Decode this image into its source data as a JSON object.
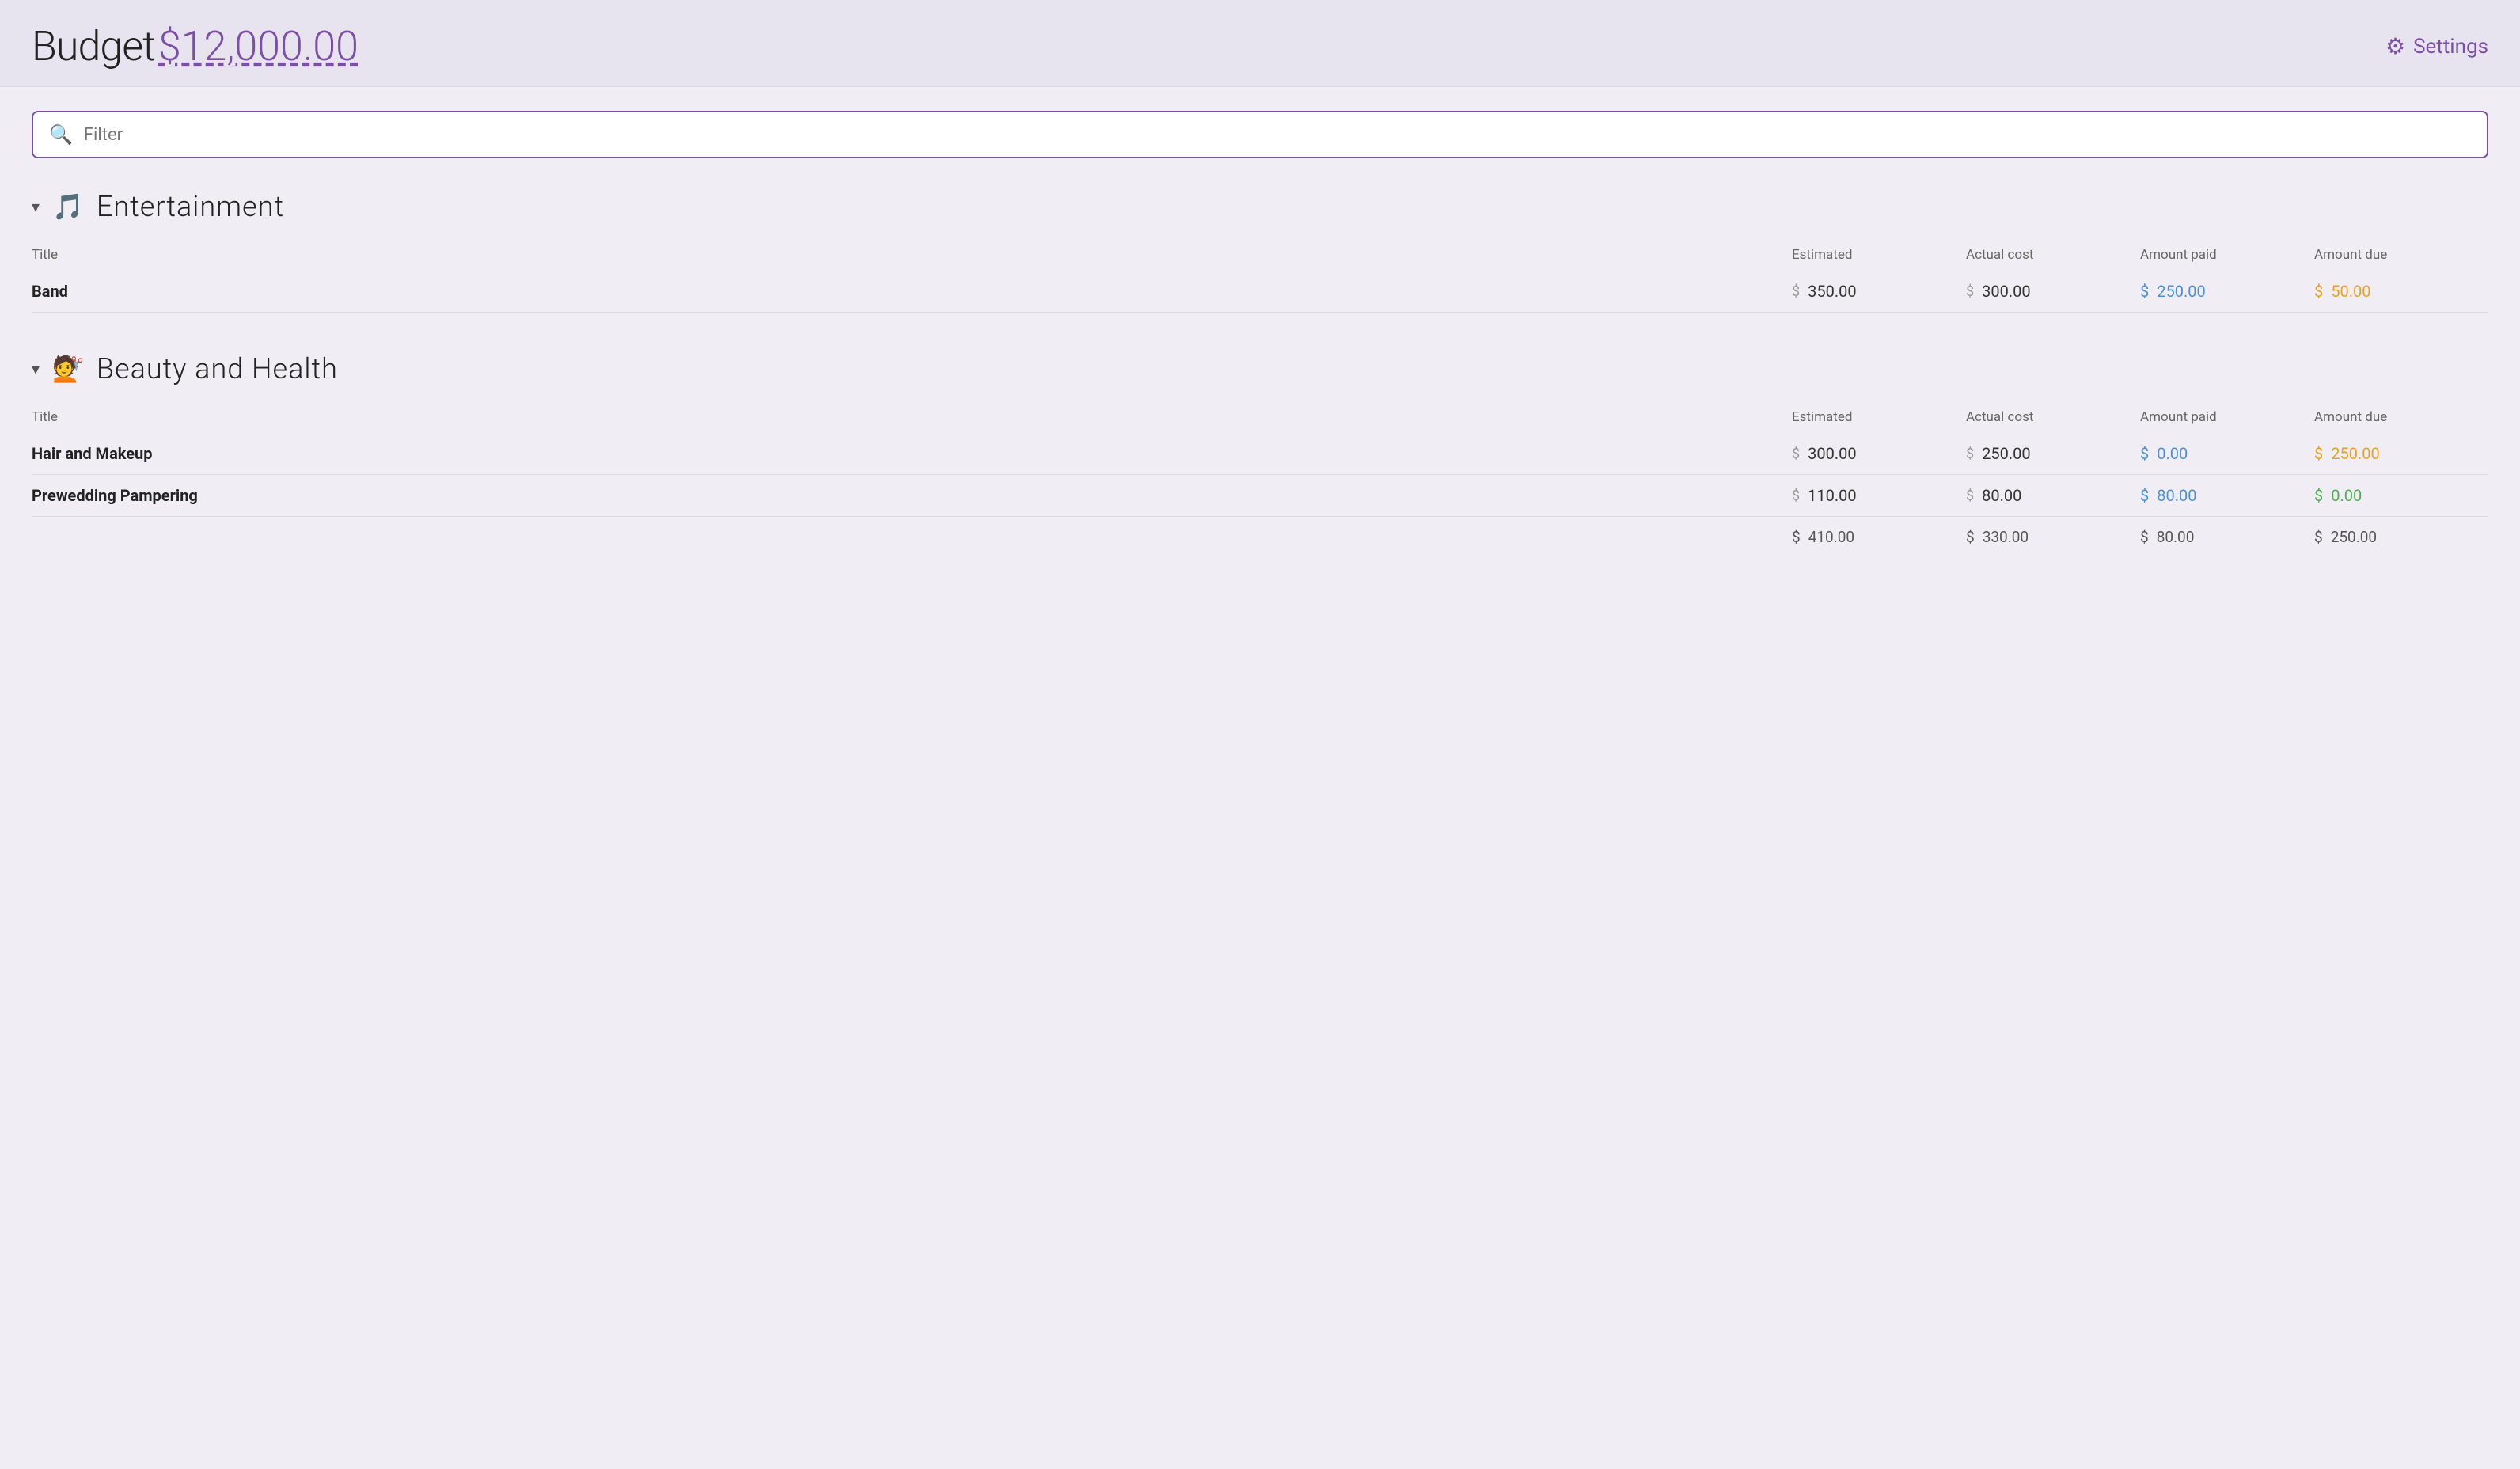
{
  "header": {
    "budget_label": "Budget",
    "budget_amount": "$12,000.00",
    "settings_label": "Settings"
  },
  "filter": {
    "placeholder": "Filter"
  },
  "categories": [
    {
      "id": "entertainment",
      "icon": "🎵",
      "title": "Entertainment",
      "columns": {
        "title": "Title",
        "estimated": "Estimated",
        "actual_cost": "Actual cost",
        "amount_paid": "Amount paid",
        "amount_due": "Amount due"
      },
      "items": [
        {
          "title": "Band",
          "estimated": "350.00",
          "actual_cost": "300.00",
          "amount_paid": "250.00",
          "amount_due": "50.00",
          "paid_color": "blue",
          "due_color": "orange"
        }
      ],
      "totals": null
    },
    {
      "id": "beauty-health",
      "icon": "💇",
      "title": "Beauty and Health",
      "columns": {
        "title": "Title",
        "estimated": "Estimated",
        "actual_cost": "Actual cost",
        "amount_paid": "Amount paid",
        "amount_due": "Amount due"
      },
      "items": [
        {
          "title": "Hair and Makeup",
          "estimated": "300.00",
          "actual_cost": "250.00",
          "amount_paid": "0.00",
          "amount_due": "250.00",
          "paid_color": "blue",
          "due_color": "orange"
        },
        {
          "title": "Prewedding Pampering",
          "estimated": "110.00",
          "actual_cost": "80.00",
          "amount_paid": "80.00",
          "amount_due": "0.00",
          "paid_color": "blue",
          "due_color": "green"
        }
      ],
      "totals": {
        "estimated": "410.00",
        "actual_cost": "330.00",
        "amount_paid": "80.00",
        "amount_due": "250.00"
      }
    }
  ],
  "icons": {
    "chevron_down": "▾",
    "search": "🔍",
    "gear": "⚙"
  }
}
